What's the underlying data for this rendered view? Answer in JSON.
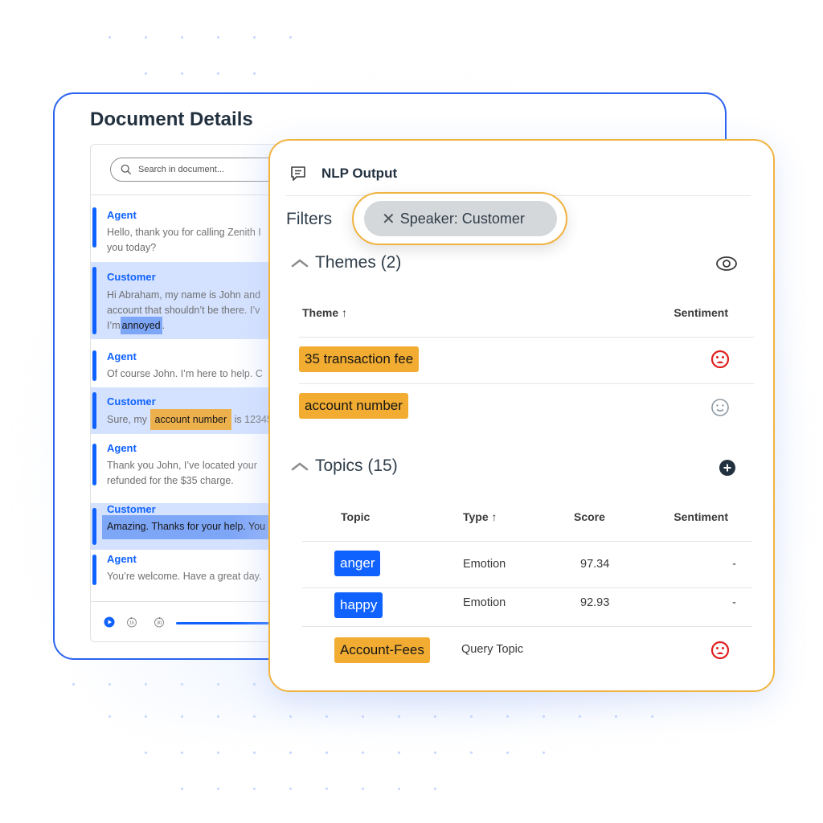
{
  "document": {
    "title": "Document Details",
    "search_placeholder": "Search in document...",
    "turns": [
      {
        "speaker": "Agent",
        "lines": [
          "Hello, thank you for calling Zenith I",
          "you today?"
        ]
      },
      {
        "speaker": "Customer",
        "lines": [
          "Hi Abraham, my name is John and",
          "account that shouldn’t be there. I’v"
        ],
        "line3_prefix": "I’m",
        "highlight": "annoyed",
        "line3_suffix": "."
      },
      {
        "speaker": "Agent",
        "lines": [
          "Of course John. I’m here to help. C"
        ]
      },
      {
        "speaker": "Customer",
        "prefix": "Sure, my",
        "highlight": "account number",
        "suffix": "is 12345"
      },
      {
        "speaker": "Agent",
        "lines": [
          "Thank you John, I’ve located your",
          "refunded for the $35 charge."
        ]
      },
      {
        "speaker": "Customer",
        "highlight_line": "Amazing. Thanks for your help. You"
      },
      {
        "speaker": "Agent",
        "lines": [
          "You’re welcome. Have a great day."
        ]
      }
    ],
    "player": {
      "play_icon": "play-icon",
      "rewind_label": "15",
      "forward_label": "30"
    }
  },
  "nlp": {
    "title": "NLP Output",
    "filters_label": "Filters",
    "filter_chip": "Speaker: Customer",
    "themes": {
      "heading": "Themes (2)",
      "col_theme": "Theme ↑",
      "col_sentiment": "Sentiment",
      "rows": [
        {
          "theme": "35 transaction fee",
          "sentiment": "negative"
        },
        {
          "theme": "account number",
          "sentiment": "neutral"
        }
      ]
    },
    "topics": {
      "heading": "Topics (15)",
      "col_topic": "Topic",
      "col_type": "Type ↑",
      "col_score": "Score",
      "col_sentiment": "Sentiment",
      "rows": [
        {
          "topic": "anger",
          "type": "Emotion",
          "score": "97.34",
          "sentiment": "-",
          "tag_color": "blue"
        },
        {
          "topic": "happy",
          "type": "Emotion",
          "score": "92.93",
          "sentiment": "-",
          "tag_color": "blue"
        },
        {
          "topic": "Account-Fees",
          "type": "Query Topic",
          "score": "",
          "sentiment": "negative",
          "tag_color": "orange"
        }
      ]
    }
  },
  "colors": {
    "primary_blue": "#0f62fe",
    "accent_orange": "#f1ac31",
    "negative_red": "#e02020",
    "neutral_gray": "#8d9aa5"
  }
}
